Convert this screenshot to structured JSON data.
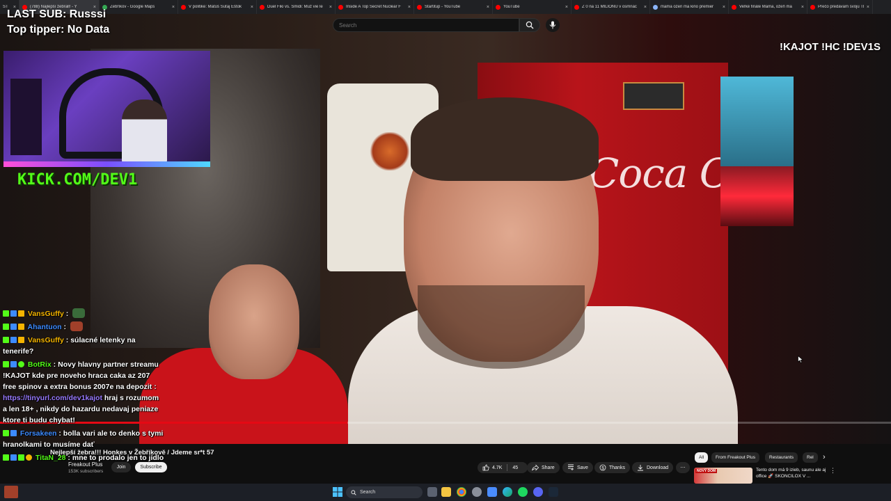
{
  "browser": {
    "tabs": [
      {
        "label": "(788) Najlepší žebrall! - Y",
        "color": "#ff0000",
        "active": true
      },
      {
        "label": "Žebříkov - Google Maps",
        "color": "#34a853"
      },
      {
        "label": "V politike: Matúš Šutaj Eštok",
        "color": "#ff0000"
      },
      {
        "label": "Duel Fiki vs. Šmidi: Muž vie le",
        "color": "#ff0000"
      },
      {
        "label": "Inside A Top Secret Nuclear F",
        "color": "#ff0000"
      },
      {
        "label": "Startitup - YouTube",
        "color": "#ff0000"
      },
      {
        "label": "YouTube",
        "color": "#ff0000"
      },
      {
        "label": "Z 0 na 11 MILIÓNŮ v osmnác",
        "color": "#ff0000"
      },
      {
        "label": "mama ozen ma kino premier",
        "color": "#8ab4f8"
      },
      {
        "label": "Veľké finále Mama, ožeň ma",
        "color": "#ff0000"
      },
      {
        "label": "Prečo predávam svoju TESLU",
        "color": "#ff0000"
      }
    ]
  },
  "overlay": {
    "last_sub": "LAST SUB: Russsi",
    "top_tipper": "Top tipper: No Data",
    "commands": "!KAJOT !HC !DEV1S",
    "kick_url": "KICK.COM/DEV1"
  },
  "search": {
    "placeholder": "Search"
  },
  "player": {
    "progress": 0.39
  },
  "video_scene": {
    "fridge_logo": "Coca Cola"
  },
  "chat": [
    {
      "badges": [
        "green",
        "blue",
        "gold"
      ],
      "user": "VansGuffy",
      "user_color": "#f5b400",
      "text": "",
      "emote": "#3a6b3a"
    },
    {
      "badges": [
        "green",
        "blue",
        "gold"
      ],
      "user": "Ahantuon",
      "user_color": "#3d8bff",
      "text": "",
      "emote": "#a0402a"
    },
    {
      "badges": [
        "green",
        "blue",
        "gold"
      ],
      "user": "VansGuffy",
      "user_color": "#f5b400",
      "text": "súlacné letenky na tenerife?"
    },
    {
      "badges": [
        "green",
        "blue",
        "green"
      ],
      "user": "BotRix",
      "user_color": "#53fc18",
      "text": "Novy hlavny partner streamu !KAJOT kde pre noveho hraca caka az 207 free spinov a extra bonus 2007e na depozit :",
      "link": "https://tinyurl.com/dev1kajot",
      "text_after": "hraj s rozumom a len 18+ , nikdy do hazardu nedavaj peniaze ktore ti budu chybat!"
    },
    {
      "badges": [
        "green",
        "blue"
      ],
      "user": "Forsakeen",
      "user_color": "#3d8bff",
      "text": "bolla vari ale to denko s tymi hranolkami to musíme dať"
    },
    {
      "badges": [
        "green",
        "blue",
        "green",
        "gold"
      ],
      "user": "TitaN_28",
      "user_color": "#53fc18",
      "text": "mne to prodalo jen to jídlo"
    }
  ],
  "video": {
    "title": "Nejlepší žebra!!! Honkes v Žebříkově / Jdeme sr*t 57",
    "channel": "Freakout Plus",
    "subscribers": "153K subscribers",
    "join_label": "Join",
    "subscribe_label": "Subscribe",
    "likes": "4.7K",
    "dislikes": "45",
    "share_label": "Share",
    "save_label": "Save",
    "thanks_label": "Thanks",
    "download_label": "Download"
  },
  "sidebar": {
    "chips": [
      "All",
      "From Freakout Plus",
      "Restaurants",
      "Rel"
    ],
    "recommended_title": "Tento dom má 9 izieb, saunu ale aj office 🚀 SKONCILOX V ...",
    "thumb_label": "NOVÝ DOM"
  },
  "taskbar": {
    "search_label": "Search"
  },
  "colors": {
    "accent": "#e50914",
    "kick_green": "#53fc18",
    "fridge_red": "#b8141a"
  }
}
